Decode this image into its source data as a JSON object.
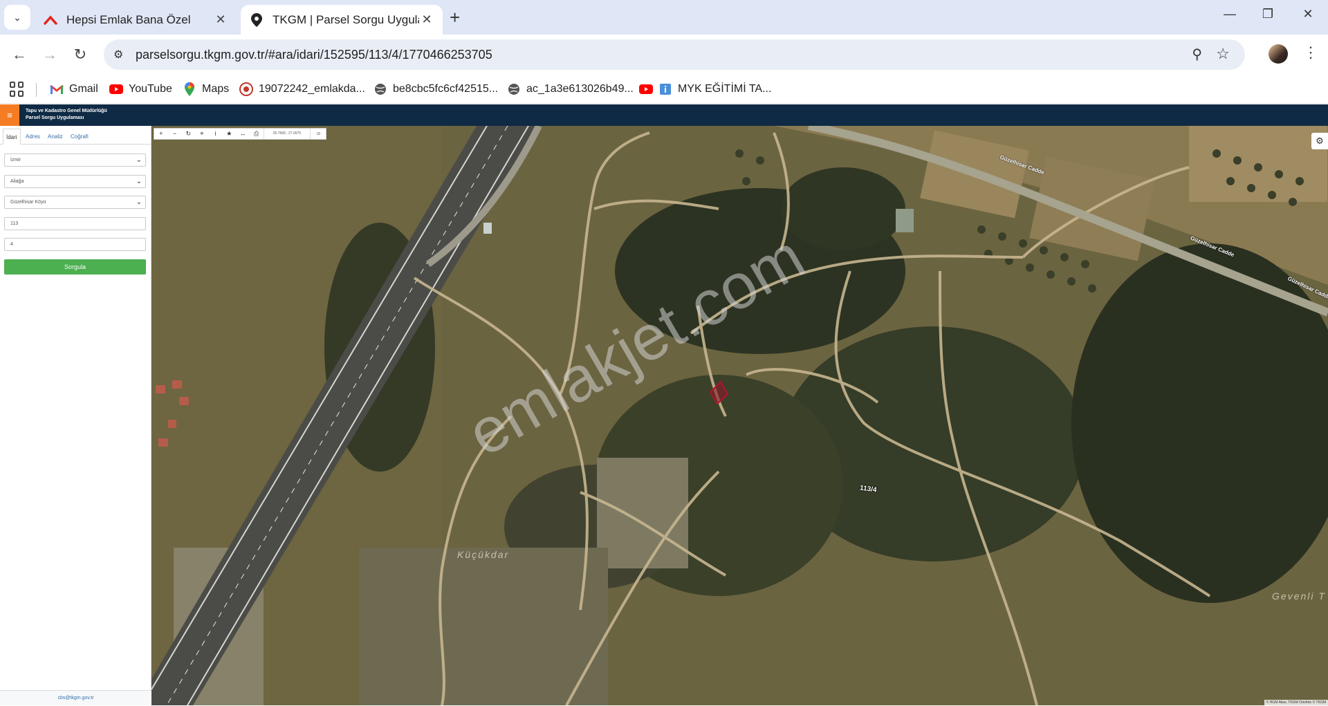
{
  "browser": {
    "tabs": [
      {
        "title": "Hepsi Emlak Bana Özel",
        "favicon": "hepsiemlak-icon",
        "active": false
      },
      {
        "title": "TKGM | Parsel Sorgu Uygulaması",
        "favicon": "location-pin-icon",
        "active": true
      }
    ],
    "url": "parselsorgu.tkgm.gov.tr/#ara/idari/152595/113/4/1770466253705",
    "bookmarks": [
      {
        "label": "Gmail",
        "icon": "gmail-icon"
      },
      {
        "label": "YouTube",
        "icon": "youtube-icon"
      },
      {
        "label": "Maps",
        "icon": "maps-icon"
      },
      {
        "label": "19072242_emlakda...",
        "icon": "seal-icon"
      },
      {
        "label": "be8cbc5fc6cf42515...",
        "icon": "globe-icon"
      },
      {
        "label": "ac_1a3e613026b49...",
        "icon": "globe-icon"
      },
      {
        "label": "MYK EĞİTİMİ TA...",
        "icon": "youtube-icon"
      }
    ]
  },
  "header": {
    "org_line1": "Tapu ve Kadastro Genel Müdürlüğü",
    "org_line2": "Parsel Sorgu Uygulaması",
    "accent": "#f57c23",
    "bg": "#0f2a44"
  },
  "sidebar": {
    "tabs": [
      "İdari",
      "Adres",
      "Analiz",
      "Coğrafi"
    ],
    "province": "İzmir",
    "district": "Aliağa",
    "neighborhood": "Güzelhisar Köyü",
    "block": "113",
    "parcel": "4",
    "query_label": "Sorgula",
    "query_color": "#4caf50",
    "footer_email": "cbs@tkgm.gov.tr"
  },
  "map": {
    "coords": "26.7666 ; 27.0075",
    "zoom": "18",
    "watermark": "emlakjet.com",
    "parcel_label": "113/4",
    "place_labels": [
      "Küçükdar",
      "Gevenli T"
    ],
    "road_labels": [
      "Güzelhisar Cadde",
      "Güzelhisar Cadde",
      "Güzelhisar Cadde"
    ],
    "attribution": "© HGM Atlas, TKGM Ortofoto © TKGM"
  }
}
